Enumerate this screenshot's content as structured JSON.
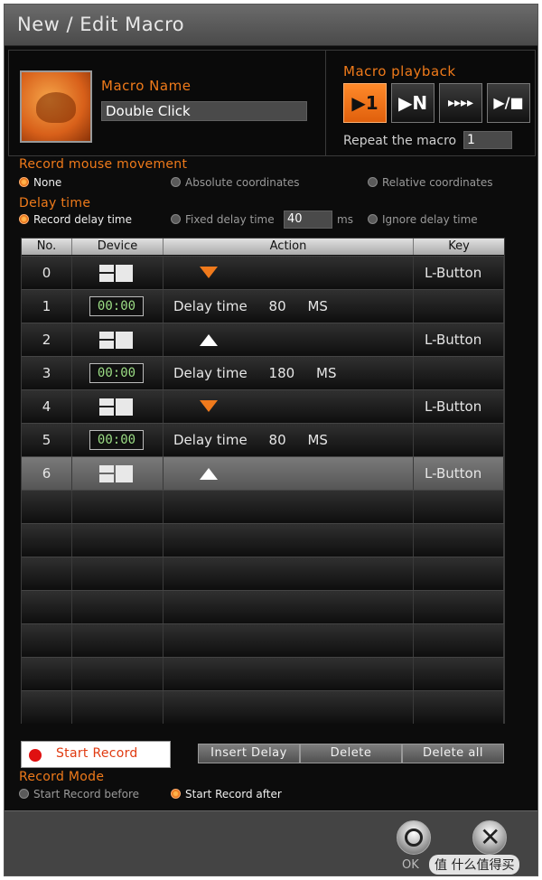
{
  "window": {
    "title": "New / Edit Macro"
  },
  "macro": {
    "name_label": "Macro Name",
    "name_value": "Double Click"
  },
  "playback": {
    "label": "Macro playback",
    "buttons": [
      {
        "glyph": "▶1",
        "icon": "play-once-icon",
        "active": true
      },
      {
        "glyph": "▶N",
        "icon": "play-n-times-icon",
        "active": false
      },
      {
        "glyph": "▸▸▸▸",
        "icon": "play-loop-icon",
        "active": false
      },
      {
        "glyph": "▶/■",
        "icon": "play-stop-icon",
        "active": false
      }
    ],
    "repeat_label": "Repeat the macro",
    "repeat_value": "1"
  },
  "mouse_movement": {
    "label": "Record mouse movement",
    "options": [
      {
        "label": "None",
        "selected": true
      },
      {
        "label": "Absolute coordinates",
        "selected": false
      },
      {
        "label": "Relative coordinates",
        "selected": false
      }
    ]
  },
  "delay": {
    "label": "Delay time",
    "options": [
      {
        "label": "Record delay time",
        "selected": true
      },
      {
        "label": "Fixed delay time",
        "selected": false
      },
      {
        "label": "Ignore delay time",
        "selected": false
      }
    ],
    "fixed_value": "40",
    "unit": "ms"
  },
  "table": {
    "headers": [
      "No.",
      "Device",
      "Action",
      "Key"
    ],
    "rows": [
      {
        "no": "0",
        "device": "mouse",
        "action": "down",
        "key": "L-Button"
      },
      {
        "no": "1",
        "device": "timer",
        "timer": "00:00",
        "delay_label": "Delay time",
        "delay_value": "80",
        "delay_unit": "MS",
        "key": ""
      },
      {
        "no": "2",
        "device": "mouse",
        "action": "up",
        "key": "L-Button"
      },
      {
        "no": "3",
        "device": "timer",
        "timer": "00:00",
        "delay_label": "Delay time",
        "delay_value": "180",
        "delay_unit": "MS",
        "key": ""
      },
      {
        "no": "4",
        "device": "mouse",
        "action": "down",
        "key": "L-Button"
      },
      {
        "no": "5",
        "device": "timer",
        "timer": "00:00",
        "delay_label": "Delay time",
        "delay_value": "80",
        "delay_unit": "MS",
        "key": ""
      },
      {
        "no": "6",
        "device": "mouse",
        "action": "up",
        "key": "L-Button",
        "selected": true
      }
    ],
    "empty_rows": 7
  },
  "actions": {
    "start_record": "Start Record",
    "insert_delay": "Insert Delay",
    "delete": "Delete",
    "delete_all": "Delete all"
  },
  "record_mode": {
    "label": "Record Mode",
    "options": [
      {
        "label": "Start Record before",
        "selected": false
      },
      {
        "label": "Start Record after",
        "selected": true
      }
    ]
  },
  "footer": {
    "ok_label": "OK",
    "watermark": "值 什么值得买"
  },
  "colors": {
    "accent": "#ef7a1a",
    "background": "#0c0c0c",
    "timer_digits": "#9bdc84"
  }
}
